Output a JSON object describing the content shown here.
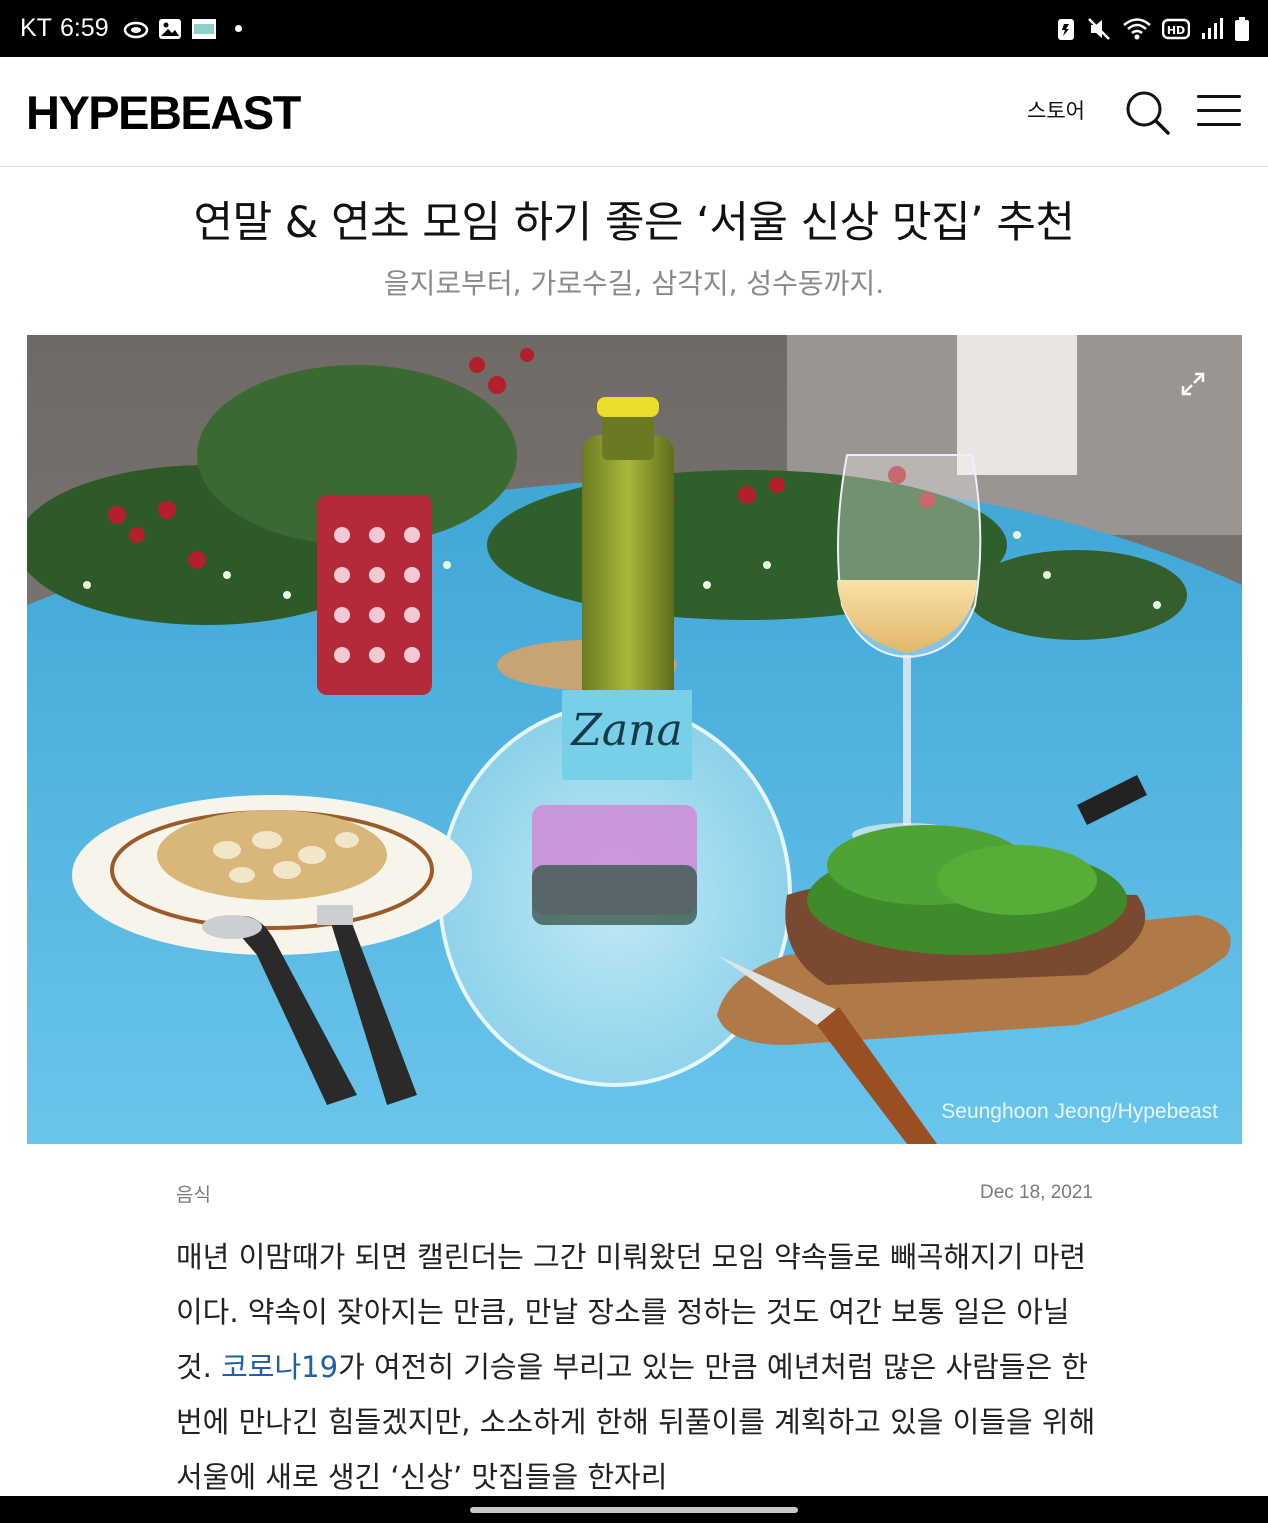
{
  "status_bar": {
    "carrier": "KT",
    "time": "6:59"
  },
  "header": {
    "logo": "HYPEBEAST",
    "store_label": "스토어"
  },
  "article": {
    "title": "연말 & 연초 모임 하기 좋은 ‘서울 신상 맛집’ 추천",
    "subtitle": "을지로부터, 가로수길, 삼각지, 성수동까지.",
    "image_credit": "Seunghoon Jeong/Hypebeast",
    "bottle_label": "Zana",
    "category": "음식",
    "date": "Dec 18, 2021",
    "body_before_link": "매년 이맘때가 되면 캘린더는 그간 미뤄왔던 모임 약속들로 빼곡해지기 마련이다. 약속이 잦아지는 만큼, 만날 장소를 정하는 것도 여간 보통 일은 아닐 것. ",
    "body_link": "코로나19",
    "body_after_link": "가 여전히 기승을 부리고 있는 만큼 예년처럼 많은 사람들은 한 번에 만나긴 힘들겠지만, 소소하게 한해 뒤풀이를 계획하고 있을 이들을 위해 서울에 새로 생긴 ‘신상’ 맛집들을 한자리"
  },
  "colors": {
    "link": "#1f5fa8",
    "meta_text": "#7a7a7a",
    "table_blue": "#5ab7e2"
  }
}
